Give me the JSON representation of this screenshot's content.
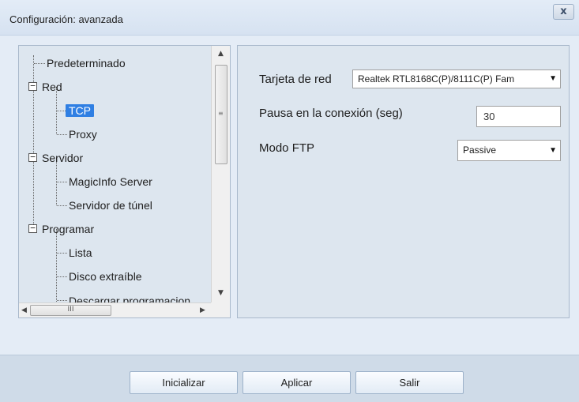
{
  "window": {
    "title": "Configuración: avanzada",
    "close_label": "x"
  },
  "tree": {
    "items": [
      {
        "label": "Predeterminado"
      },
      {
        "label": "Red",
        "expander": "−"
      },
      {
        "label": "TCP",
        "selected": true
      },
      {
        "label": "Proxy"
      },
      {
        "label": "Servidor",
        "expander": "−"
      },
      {
        "label": "MagicInfo Server"
      },
      {
        "label": "Servidor de túnel"
      },
      {
        "label": "Programar",
        "expander": "−"
      },
      {
        "label": "Lista"
      },
      {
        "label": "Disco extraíble"
      },
      {
        "label": "Descargar programacion"
      }
    ],
    "hscroll_grip": "III"
  },
  "settings": {
    "network_card_label": "Tarjeta de red",
    "network_card_value": "Realtek RTL8168C(P)/8111C(P) Fam",
    "timeout_label": "Pausa en la conexión (seg)",
    "timeout_value": "30",
    "ftp_mode_label": "Modo FTP",
    "ftp_mode_value": "Passive"
  },
  "buttons": {
    "initialize": "Inicializar",
    "apply": "Aplicar",
    "exit": "Salir"
  }
}
